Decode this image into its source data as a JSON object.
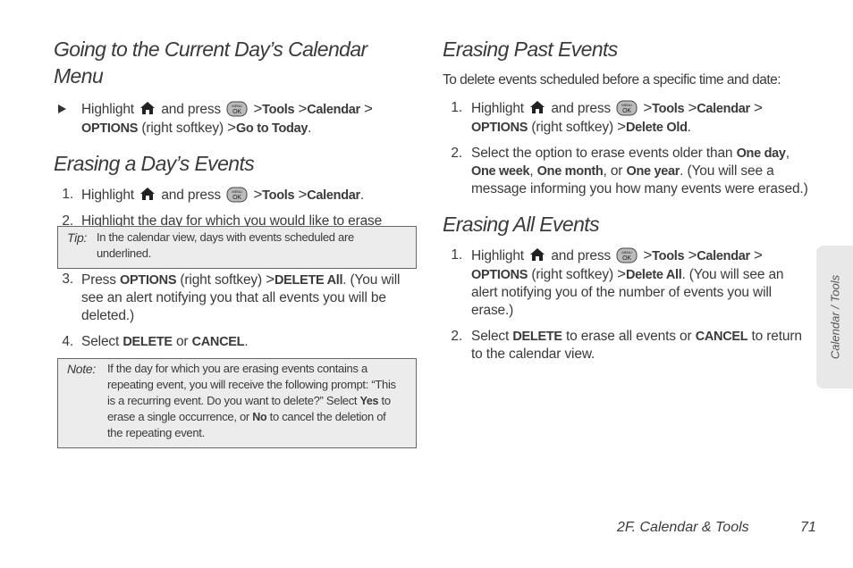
{
  "left": {
    "section1": {
      "title": "Going to the Current Day’s Calendar Menu",
      "bullet": {
        "pre": "Highlight",
        "mid": "and press",
        "path1": "Tools",
        "path2": "Calendar",
        "path3": "OPTIONS",
        "paren": "(right softkey)",
        "path4": "Go to Today",
        "end": "."
      }
    },
    "section2": {
      "title": "Erasing a Day’s Events",
      "step1": {
        "num": "1.",
        "pre": "Highlight",
        "mid": "and press",
        "path1": "Tools",
        "path2": "Calendar",
        "end": "."
      },
      "step2": {
        "num": "2.",
        "text": "Highlight the day for which you would like to erase events and press",
        "end": "."
      },
      "tip": {
        "label": "Tip:",
        "text": "In the calendar view, days with events scheduled are underlined."
      },
      "step3": {
        "num": "3.",
        "pre": "Press",
        "b1": "OPTIONS",
        "mid": "(right softkey)",
        "b2": "DELETE All",
        "post": ". (You will see an alert notifying you that all events you will be deleted.)"
      },
      "step4": {
        "num": "4.",
        "pre": "Select",
        "b1": "DELETE",
        "mid": "or",
        "b2": "CANCEL",
        "end": "."
      },
      "note": {
        "label": "Note:",
        "line1": "If the day for which you are erasing events contains a repeating event, you will receive the following prompt: “This is a recurring event. Do you want to delete?”",
        "pre": "Select",
        "b1": "Yes",
        "mid": "to erase a single occurrence, or",
        "b2": "No",
        "post": "to cancel the deletion of the repeating event."
      }
    }
  },
  "right": {
    "section3": {
      "title": "Erasing Past Events",
      "intro": "To delete events scheduled before a specific time and date:",
      "step1": {
        "num": "1.",
        "pre": "Highlight",
        "mid": "and press",
        "path1": "Tools",
        "path2": "Calendar",
        "path3": "OPTIONS",
        "paren": "(right softkey)",
        "path4": "Delete Old",
        "end": "."
      },
      "step2": {
        "num": "2.",
        "pre": "Select the option to erase events older than",
        "b1": "One day",
        "b2": "One week",
        "b3": "One month",
        "or": "or",
        "b4": "One year",
        "post": ". (You will see a message informing you how many events were erased.)"
      }
    },
    "section4": {
      "title": "Erasing All Events",
      "step1": {
        "num": "1.",
        "pre": "Highlight",
        "mid": "and press",
        "path1": "Tools",
        "path2": "Calendar",
        "path3": "OPTIONS",
        "paren": "(right softkey)",
        "path4": "Delete All",
        "post": ". (You will see an alert notifying you of the number of events you will erase.)"
      },
      "step2": {
        "num": "2.",
        "pre": "Select",
        "b1": "DELETE",
        "mid": "to erase all events or",
        "b2": "CANCEL",
        "post": "to return to the calendar view."
      }
    }
  },
  "side_tab": "Calendar / Tools",
  "footer": {
    "section": "2F. Calendar & Tools",
    "page": "71"
  },
  "glyphs": {
    "gt": ">",
    "comma": ","
  }
}
